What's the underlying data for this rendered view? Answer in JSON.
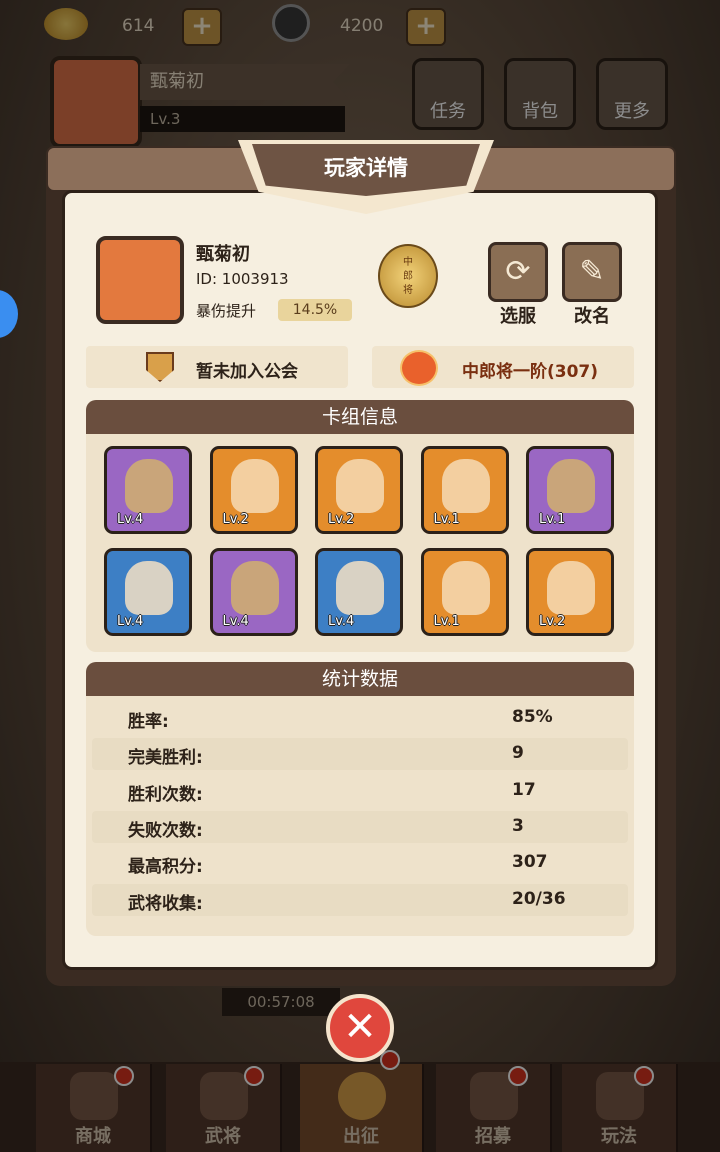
{
  "resources": {
    "gold": "614",
    "coins": "4200",
    "gold_icon": "gold-ingot-icon",
    "coin_icon": "coin-icon"
  },
  "header": {
    "name": "甄菊初",
    "level": "Lv.3"
  },
  "top_buttons": [
    {
      "label": "任务",
      "icon": "scroll-icon"
    },
    {
      "label": "背包",
      "icon": "bag-icon"
    },
    {
      "label": "更多",
      "icon": "menu-icon"
    }
  ],
  "panel": {
    "title": "玩家详情",
    "player_name": "甄菊初",
    "player_id": "ID: 1003913",
    "crit_label": "暴伤提升",
    "crit_value": "14.5%",
    "rank_badge": "中郎将",
    "skin_label": "选服",
    "rename_label": "改名",
    "guild_text": "暂未加入公会",
    "rank_text": "中郎将一阶(307)"
  },
  "deck": {
    "title": "卡组信息",
    "cards": [
      {
        "lv": "Lv.4",
        "color": "purple"
      },
      {
        "lv": "Lv.2",
        "color": "orange"
      },
      {
        "lv": "Lv.2",
        "color": "orange"
      },
      {
        "lv": "Lv.1",
        "color": "orange"
      },
      {
        "lv": "Lv.1",
        "color": "purple"
      },
      {
        "lv": "Lv.4",
        "color": "blue"
      },
      {
        "lv": "Lv.4",
        "color": "purple"
      },
      {
        "lv": "Lv.4",
        "color": "blue"
      },
      {
        "lv": "Lv.1",
        "color": "orange"
      },
      {
        "lv": "Lv.2",
        "color": "orange"
      }
    ]
  },
  "stats": {
    "title": "统计数据",
    "rows": [
      {
        "label": "胜率:",
        "value": "85%"
      },
      {
        "label": "完美胜利:",
        "value": "9"
      },
      {
        "label": "胜利次数:",
        "value": "17"
      },
      {
        "label": "失败次数:",
        "value": "3"
      },
      {
        "label": "最高积分:",
        "value": "307"
      },
      {
        "label": "武将收集:",
        "value": "20/36"
      }
    ]
  },
  "timer": "00:57:08",
  "bottom_nav": [
    {
      "label": "商城"
    },
    {
      "label": "武将"
    },
    {
      "label": "出征"
    },
    {
      "label": "招募"
    },
    {
      "label": "玩法"
    }
  ]
}
